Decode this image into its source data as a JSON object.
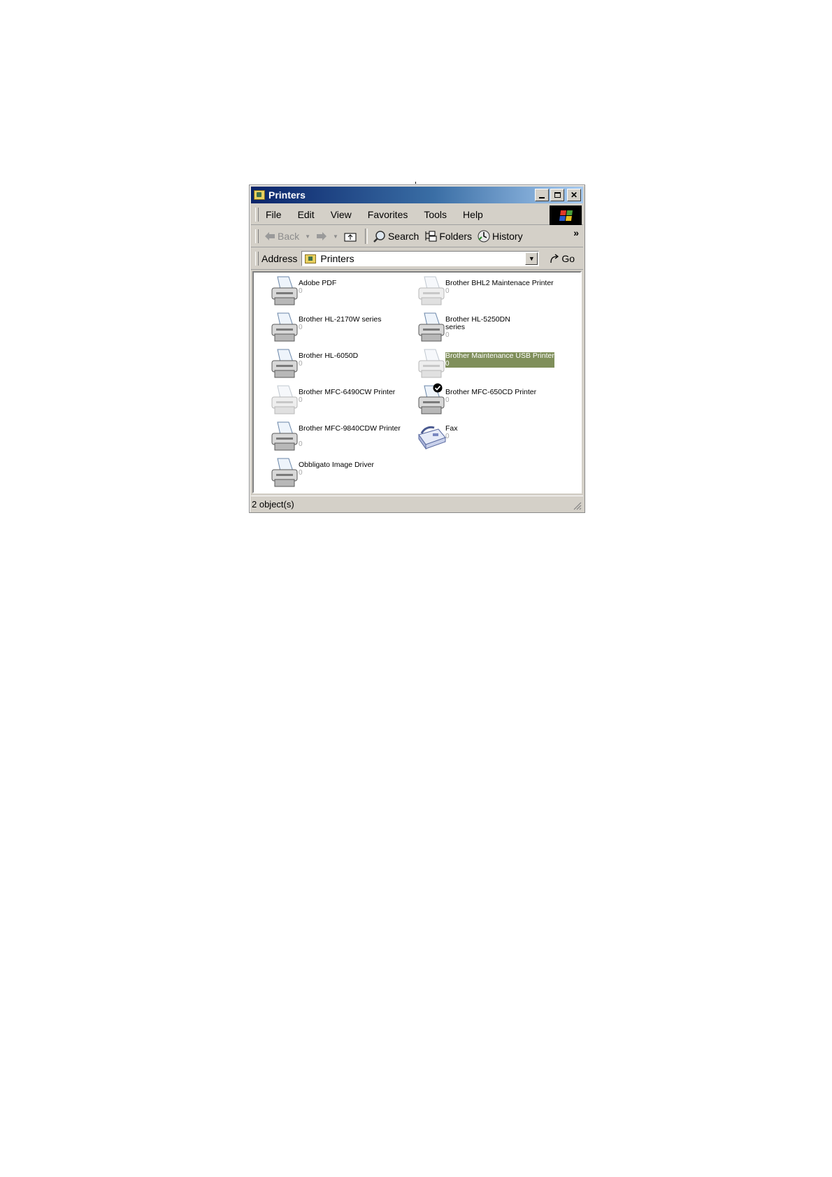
{
  "window": {
    "title": "Printers"
  },
  "menu": [
    "File",
    "Edit",
    "View",
    "Favorites",
    "Tools",
    "Help"
  ],
  "toolbar": {
    "back_label": "Back",
    "search_label": "Search",
    "folders_label": "Folders",
    "history_label": "History",
    "more_label": "»"
  },
  "address": {
    "label": "Address",
    "value": "Printers",
    "go_label": "Go"
  },
  "items": [
    {
      "name": "Adobe PDF",
      "docs": "0",
      "state": "normal"
    },
    {
      "name": "Brother BHL2 Maintenace Printer",
      "docs": "0",
      "state": "offline"
    },
    {
      "name": "Brother HL-2170W series",
      "docs": "0",
      "state": "normal"
    },
    {
      "name": "Brother HL-5250DN",
      "name2": "series",
      "docs": "0",
      "state": "normal"
    },
    {
      "name": "Brother HL-6050D",
      "docs": "0",
      "state": "normal"
    },
    {
      "name": "Brother Maintenance USB Printer",
      "docs": "0",
      "state": "offline-selected"
    },
    {
      "name": "Brother MFC-6490CW Printer",
      "docs": "0",
      "state": "offline"
    },
    {
      "name": "Brother MFC-650CD Printer",
      "docs": "0",
      "state": "default"
    },
    {
      "name": "Brother MFC-9840CDW Printer",
      "docs": "0",
      "state": "normal"
    },
    {
      "name": "Fax",
      "docs": "0",
      "state": "fax"
    },
    {
      "name": "Obbligato Image Driver",
      "docs": "0",
      "state": "normal"
    }
  ],
  "status": {
    "text": "2 object(s)"
  },
  "colors": {
    "title_start": "#0a246a",
    "title_end": "#a6caf0",
    "selection": "#7f8f5a",
    "face": "#d4d0c8"
  }
}
